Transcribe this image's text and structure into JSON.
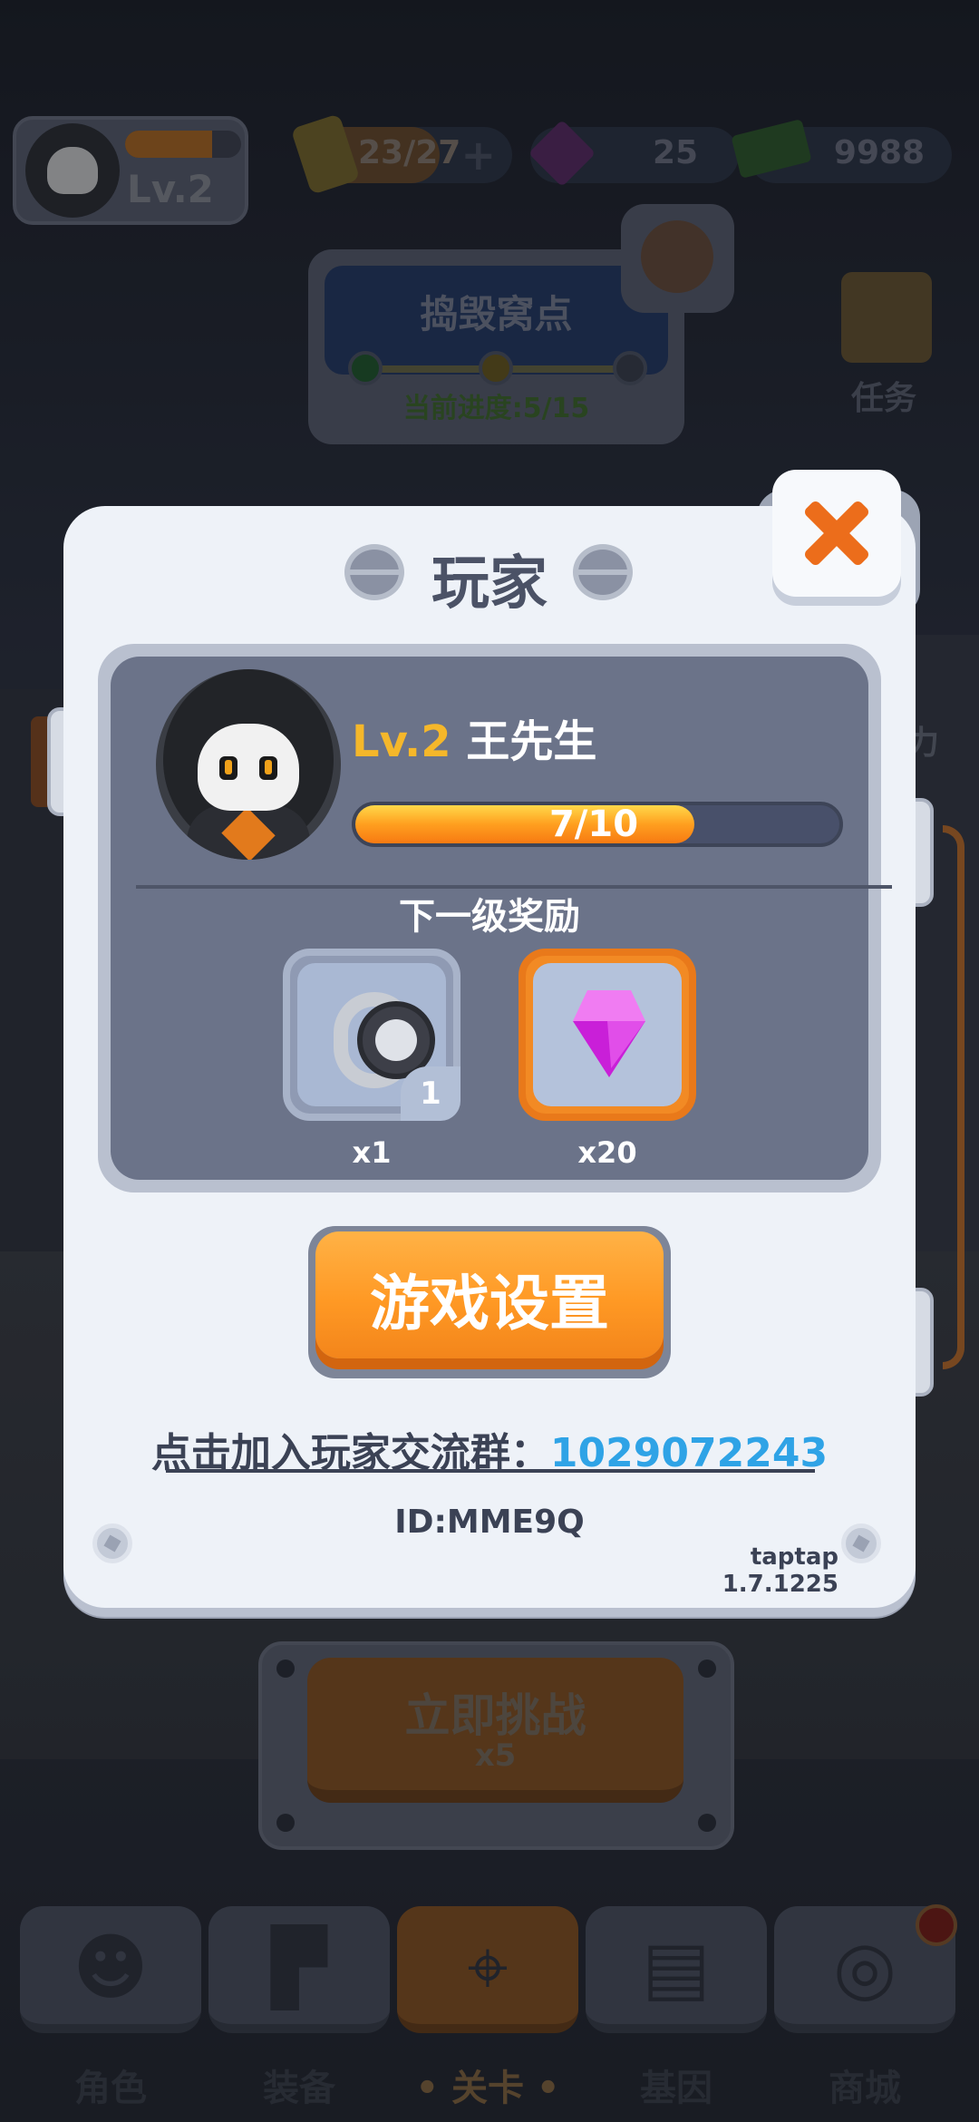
{
  "hud": {
    "level": "Lv.2",
    "energy": "23/27",
    "energy_plus": "+",
    "gems": "25",
    "cash": "9988"
  },
  "mission": {
    "title": "捣毁窝点",
    "progress": "当前进度:5/15"
  },
  "side": {
    "task_label": "任务",
    "power_label": "力"
  },
  "challenge": {
    "label": "立即挑战",
    "cost": "x5"
  },
  "nav": {
    "tabs": [
      {
        "label": "角色",
        "icon": "skull-icon"
      },
      {
        "label": "装备",
        "icon": "gun-icon"
      },
      {
        "label": "• 关卡 •",
        "icon": "map-pin-icon"
      },
      {
        "label": "基因",
        "icon": "lock-icon"
      },
      {
        "label": "商城",
        "icon": "shop-icon"
      }
    ],
    "active_index": 2
  },
  "modal": {
    "title": "玩家",
    "player": {
      "level": "Lv.2",
      "name": "王先生",
      "xp_text": "7/10",
      "xp_fraction": 0.7
    },
    "reward_title": "下一级奖励",
    "rewards": [
      {
        "icon": "watch-icon",
        "badge": "1",
        "qty": "x1"
      },
      {
        "icon": "gem-icon",
        "qty": "x20"
      }
    ],
    "settings_button": "游戏设置",
    "join_text": "点击加入玩家交流群：",
    "join_number": "1029072243",
    "player_id": "ID:MME9Q",
    "version": "taptap 1.7.1225"
  },
  "colors": {
    "accent_orange": "#ff9924",
    "level_gold": "#f5b72a",
    "link_blue": "#2fa3e6",
    "close_x": "#ec6d1b"
  }
}
